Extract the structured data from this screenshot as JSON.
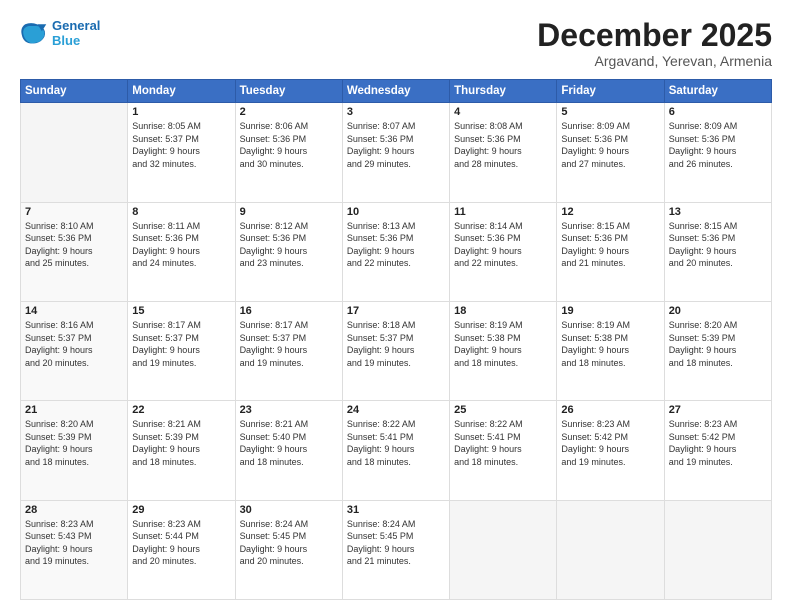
{
  "header": {
    "logo_line1": "General",
    "logo_line2": "Blue",
    "month": "December 2025",
    "location": "Argavand, Yerevan, Armenia"
  },
  "weekdays": [
    "Sunday",
    "Monday",
    "Tuesday",
    "Wednesday",
    "Thursday",
    "Friday",
    "Saturday"
  ],
  "weeks": [
    [
      {
        "day": "",
        "info": ""
      },
      {
        "day": "1",
        "info": "Sunrise: 8:05 AM\nSunset: 5:37 PM\nDaylight: 9 hours\nand 32 minutes."
      },
      {
        "day": "2",
        "info": "Sunrise: 8:06 AM\nSunset: 5:36 PM\nDaylight: 9 hours\nand 30 minutes."
      },
      {
        "day": "3",
        "info": "Sunrise: 8:07 AM\nSunset: 5:36 PM\nDaylight: 9 hours\nand 29 minutes."
      },
      {
        "day": "4",
        "info": "Sunrise: 8:08 AM\nSunset: 5:36 PM\nDaylight: 9 hours\nand 28 minutes."
      },
      {
        "day": "5",
        "info": "Sunrise: 8:09 AM\nSunset: 5:36 PM\nDaylight: 9 hours\nand 27 minutes."
      },
      {
        "day": "6",
        "info": "Sunrise: 8:09 AM\nSunset: 5:36 PM\nDaylight: 9 hours\nand 26 minutes."
      }
    ],
    [
      {
        "day": "7",
        "info": ""
      },
      {
        "day": "8",
        "info": "Sunrise: 8:11 AM\nSunset: 5:36 PM\nDaylight: 9 hours\nand 24 minutes."
      },
      {
        "day": "9",
        "info": "Sunrise: 8:12 AM\nSunset: 5:36 PM\nDaylight: 9 hours\nand 23 minutes."
      },
      {
        "day": "10",
        "info": "Sunrise: 8:13 AM\nSunset: 5:36 PM\nDaylight: 9 hours\nand 22 minutes."
      },
      {
        "day": "11",
        "info": "Sunrise: 8:14 AM\nSunset: 5:36 PM\nDaylight: 9 hours\nand 22 minutes."
      },
      {
        "day": "12",
        "info": "Sunrise: 8:15 AM\nSunset: 5:36 PM\nDaylight: 9 hours\nand 21 minutes."
      },
      {
        "day": "13",
        "info": "Sunrise: 8:15 AM\nSunset: 5:36 PM\nDaylight: 9 hours\nand 20 minutes."
      }
    ],
    [
      {
        "day": "14",
        "info": ""
      },
      {
        "day": "15",
        "info": "Sunrise: 8:17 AM\nSunset: 5:37 PM\nDaylight: 9 hours\nand 19 minutes."
      },
      {
        "day": "16",
        "info": "Sunrise: 8:17 AM\nSunset: 5:37 PM\nDaylight: 9 hours\nand 19 minutes."
      },
      {
        "day": "17",
        "info": "Sunrise: 8:18 AM\nSunset: 5:37 PM\nDaylight: 9 hours\nand 19 minutes."
      },
      {
        "day": "18",
        "info": "Sunrise: 8:19 AM\nSunset: 5:38 PM\nDaylight: 9 hours\nand 18 minutes."
      },
      {
        "day": "19",
        "info": "Sunrise: 8:19 AM\nSunset: 5:38 PM\nDaylight: 9 hours\nand 18 minutes."
      },
      {
        "day": "20",
        "info": "Sunrise: 8:20 AM\nSunset: 5:39 PM\nDaylight: 9 hours\nand 18 minutes."
      }
    ],
    [
      {
        "day": "21",
        "info": ""
      },
      {
        "day": "22",
        "info": "Sunrise: 8:21 AM\nSunset: 5:39 PM\nDaylight: 9 hours\nand 18 minutes."
      },
      {
        "day": "23",
        "info": "Sunrise: 8:21 AM\nSunset: 5:40 PM\nDaylight: 9 hours\nand 18 minutes."
      },
      {
        "day": "24",
        "info": "Sunrise: 8:22 AM\nSunset: 5:41 PM\nDaylight: 9 hours\nand 18 minutes."
      },
      {
        "day": "25",
        "info": "Sunrise: 8:22 AM\nSunset: 5:41 PM\nDaylight: 9 hours\nand 18 minutes."
      },
      {
        "day": "26",
        "info": "Sunrise: 8:23 AM\nSunset: 5:42 PM\nDaylight: 9 hours\nand 19 minutes."
      },
      {
        "day": "27",
        "info": "Sunrise: 8:23 AM\nSunset: 5:42 PM\nDaylight: 9 hours\nand 19 minutes."
      }
    ],
    [
      {
        "day": "28",
        "info": "Sunrise: 8:23 AM\nSunset: 5:43 PM\nDaylight: 9 hours\nand 19 minutes."
      },
      {
        "day": "29",
        "info": "Sunrise: 8:23 AM\nSunset: 5:44 PM\nDaylight: 9 hours\nand 20 minutes."
      },
      {
        "day": "30",
        "info": "Sunrise: 8:24 AM\nSunset: 5:45 PM\nDaylight: 9 hours\nand 20 minutes."
      },
      {
        "day": "31",
        "info": "Sunrise: 8:24 AM\nSunset: 5:45 PM\nDaylight: 9 hours\nand 21 minutes."
      },
      {
        "day": "",
        "info": ""
      },
      {
        "day": "",
        "info": ""
      },
      {
        "day": "",
        "info": ""
      }
    ]
  ],
  "week7_sunday": "Sunrise: 8:10 AM\nSunset: 5:36 PM\nDaylight: 9 hours\nand 25 minutes.",
  "week14_sunday": "Sunrise: 8:16 AM\nSunset: 5:37 PM\nDaylight: 9 hours\nand 20 minutes.",
  "week21_sunday": "Sunrise: 8:20 AM\nSunset: 5:39 PM\nDaylight: 9 hours\nand 18 minutes."
}
